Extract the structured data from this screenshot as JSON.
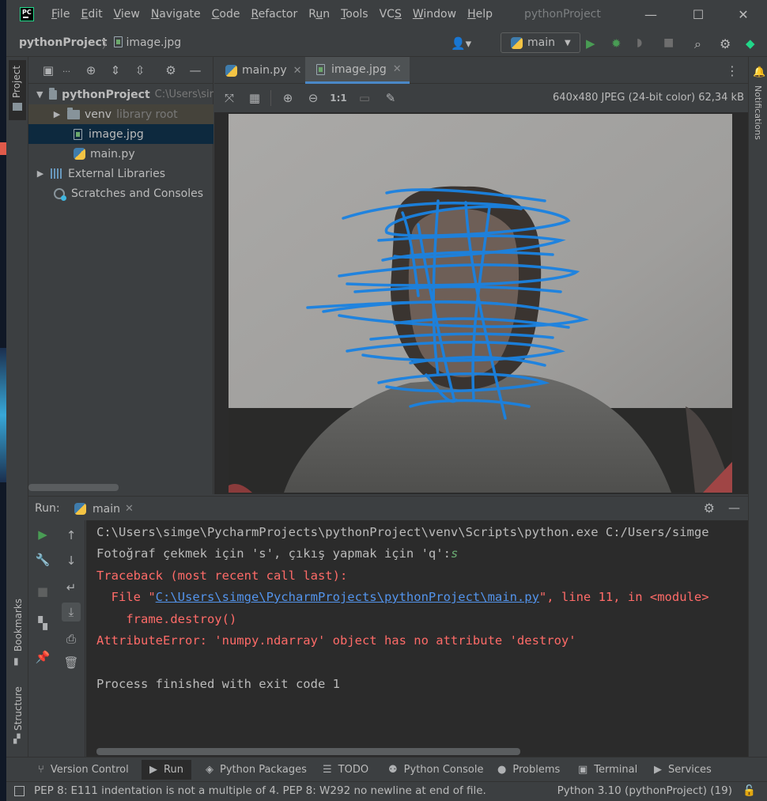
{
  "window": {
    "title": "pythonProject",
    "menu": [
      {
        "pre": "",
        "ul": "F",
        "post": "ile"
      },
      {
        "pre": "",
        "ul": "E",
        "post": "dit"
      },
      {
        "pre": "",
        "ul": "V",
        "post": "iew"
      },
      {
        "pre": "",
        "ul": "N",
        "post": "avigate"
      },
      {
        "pre": "",
        "ul": "C",
        "post": "ode"
      },
      {
        "pre": "",
        "ul": "R",
        "post": "efactor"
      },
      {
        "pre": "R",
        "ul": "u",
        "post": "n"
      },
      {
        "pre": "",
        "ul": "T",
        "post": "ools"
      },
      {
        "pre": "VC",
        "ul": "S",
        "post": ""
      },
      {
        "pre": "",
        "ul": "W",
        "post": "indow"
      },
      {
        "pre": "",
        "ul": "H",
        "post": "elp"
      }
    ],
    "controls": {
      "minimize": "—",
      "maximize": "☐",
      "close": "✕"
    }
  },
  "navbar": {
    "project": "pythonProject",
    "file": "image.jpg",
    "run_config": "main"
  },
  "side_stripes": {
    "project": "Project",
    "bookmarks": "Bookmarks",
    "structure": "Structure",
    "notifications": "Notifications"
  },
  "project_tree": {
    "root": {
      "name": "pythonProject",
      "path": "C:\\Users\\sir"
    },
    "venv": {
      "name": "venv",
      "hint": "library root"
    },
    "image": "image.jpg",
    "main": "main.py",
    "external": "External Libraries",
    "scratches": "Scratches and Consoles"
  },
  "editor": {
    "tabs": [
      {
        "label": "main.py",
        "active": false
      },
      {
        "label": "image.jpg",
        "active": true
      }
    ],
    "image_info": "640x480 JPEG (24-bit color) 62,34 kB",
    "zoom_actual": "1:1"
  },
  "run": {
    "label": "Run:",
    "tab": "main",
    "console": {
      "cmd": "C:\\Users\\simge\\PycharmProjects\\pythonProject\\venv\\Scripts\\python.exe C:/Users/simge",
      "prompt": "Fotoğraf çekmek için 's', çıkış yapmak için 'q':",
      "input": "s",
      "traceback": "Traceback (most recent call last):",
      "file_pre": "  File \"",
      "file_link": "C:\\Users\\simge\\PycharmProjects\\pythonProject\\main.py",
      "file_post": "\", line 11, in <module>",
      "code": "    frame.destroy()",
      "error": "AttributeError: 'numpy.ndarray' object has no attribute 'destroy'",
      "exit": "Process finished with exit code 1"
    }
  },
  "bottom_tools": [
    {
      "label": "Version Control",
      "icon": "version-control-icon",
      "active": false
    },
    {
      "label": "Run",
      "icon": "run-icon",
      "active": true
    },
    {
      "label": "Python Packages",
      "icon": "packages-icon",
      "active": false
    },
    {
      "label": "TODO",
      "icon": "todo-icon",
      "active": false
    },
    {
      "label": "Python Console",
      "icon": "python-console-icon",
      "active": false
    },
    {
      "label": "Problems",
      "icon": "problems-icon",
      "active": false
    },
    {
      "label": "Terminal",
      "icon": "terminal-icon",
      "active": false
    },
    {
      "label": "Services",
      "icon": "services-icon",
      "active": false
    }
  ],
  "status": {
    "message": "PEP 8: E111 indentation is not a multiple of 4. PEP 8: W292 no newline at end of file.",
    "interpreter": "Python 3.10 (pythonProject) (19)"
  },
  "colors": {
    "accent": "#4a88c7",
    "error": "#ff6b68",
    "link": "#5394ec",
    "run_green": "#499c54",
    "scribble": "#1a82e2"
  }
}
